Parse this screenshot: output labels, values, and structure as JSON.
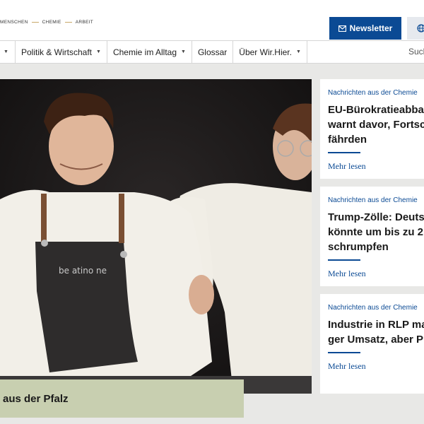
{
  "header": {
    "tagline": [
      "MENSCHEN",
      "CHEMIE",
      "ARBEIT"
    ],
    "newsletter_label": "Newsletter"
  },
  "nav": {
    "items": [
      {
        "label": "Politik & Wirtschaft",
        "dropdown": true
      },
      {
        "label": "Chemie im Alltag",
        "dropdown": true
      },
      {
        "label": "Glossar",
        "dropdown": false
      },
      {
        "label": "Über Wir.Hier.",
        "dropdown": true
      }
    ],
    "search_label": "Such"
  },
  "hero": {
    "caption": "aus der Pfalz"
  },
  "cards": [
    {
      "kicker": "Nachrichten aus der Chemie",
      "title": "EU-Bürokratieabba\nwarnt davor, Fortsc\nfährden",
      "more": "Mehr lesen"
    },
    {
      "kicker": "Nachrichten aus der Chemie",
      "title": "Trump-Zölle: Deuts\nkönnte um bis zu 2,\nschrumpfen",
      "more": "Mehr lesen"
    },
    {
      "kicker": "Nachrichten aus der Chemie",
      "title": "Industrie in RLP ma\nger Umsatz, aber Pl",
      "more": "Mehr lesen"
    }
  ],
  "colors": {
    "brand_blue": "#0b4a94",
    "caption_bg": "#c8cfb0",
    "page_bg": "#e8e8e6"
  }
}
